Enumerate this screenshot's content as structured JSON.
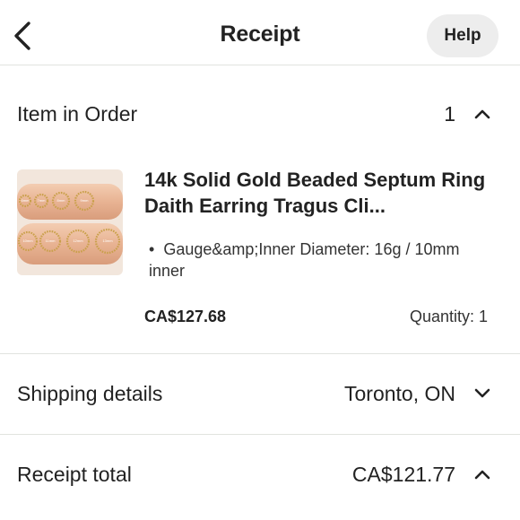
{
  "header": {
    "title": "Receipt",
    "help_label": "Help"
  },
  "item_section": {
    "label": "Item in Order",
    "count": "1"
  },
  "product": {
    "title": "14k Solid Gold Beaded Septum Ring Daith Earring Tragus Cli...",
    "variation": "Gauge&amp;Inner Diameter: 16g / 10mm inner",
    "price": "CA$127.68",
    "quantity": "Quantity: 1",
    "image_labels": [
      "6mm",
      "7mm",
      "8mm",
      "9mm",
      "10mm",
      "11mm",
      "12mm",
      "13mm"
    ]
  },
  "shipping": {
    "label": "Shipping details",
    "value": "Toronto, ON"
  },
  "total": {
    "label": "Receipt total",
    "value": "CA$121.77"
  },
  "colors": {
    "text": "#222222",
    "divider": "#e1e3df",
    "help_bg": "#ededed",
    "thumb_bg": "#e9b99a"
  },
  "icons": {
    "back": "chevron-left-icon",
    "item_toggle": "chevron-up-icon",
    "shipping_toggle": "chevron-down-icon",
    "total_toggle": "chevron-up-icon"
  }
}
